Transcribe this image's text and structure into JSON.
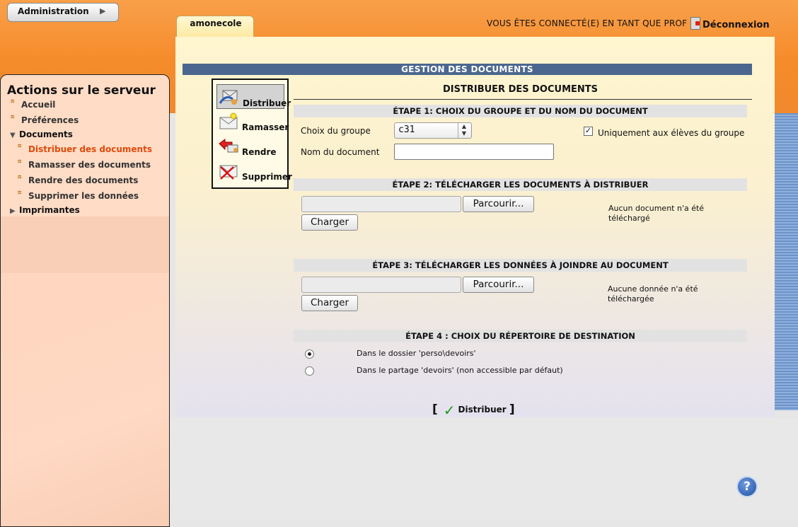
{
  "header": {
    "admin_label": "Administration",
    "tab_label": "amonecole",
    "connected_text": "VOUS ÊTES CONNECTÉ(E) EN TANT QUE PROF",
    "logout_label": "Déconnexion"
  },
  "sidebar": {
    "title": "Actions sur le serveur",
    "items": [
      {
        "label": "Accueil"
      },
      {
        "label": "Préférences"
      },
      {
        "label": "Documents"
      },
      {
        "label": "Distribuer des documents"
      },
      {
        "label": "Ramasser des documents"
      },
      {
        "label": "Rendre des documents"
      },
      {
        "label": "Supprimer les données"
      },
      {
        "label": "Imprimantes"
      }
    ]
  },
  "main": {
    "section_title": "GESTION DES DOCUMENTS",
    "page_title": "DISTRIBUER DES DOCUMENTS",
    "toolbar": [
      {
        "label": "Distribuer"
      },
      {
        "label": "Ramasser"
      },
      {
        "label": "Rendre"
      },
      {
        "label": "Supprimer"
      }
    ],
    "step1": {
      "title": "ÉTAPE 1: CHOIX DU GROUPE ET DU NOM DU DOCUMENT",
      "group_label": "Choix du groupe",
      "group_value": "c31",
      "only_group_label": "Uniquement aux élèves du groupe",
      "doc_name_label": "Nom du document",
      "doc_name_value": ""
    },
    "step2": {
      "title": "ÉTAPE 2: TÉLÉCHARGER LES DOCUMENTS À DISTRIBUER",
      "browse_label": "Parcourir...",
      "load_label": "Charger",
      "status_line1": "Aucun document n'a été",
      "status_line2": "téléchargé"
    },
    "step3": {
      "title": "ÉTAPE 3: TÉLÉCHARGER LES DONNÉES À JOINDRE AU DOCUMENT",
      "browse_label": "Parcourir...",
      "load_label": "Charger",
      "status_line1": "Aucune donnée n'a été",
      "status_line2": "téléchargée"
    },
    "step4": {
      "title": "ÉTAPE 4 : CHOIX DU RÉPERTOIRE DE DESTINATION",
      "option1": "Dans le dossier 'perso\\devoirs'",
      "option2": "Dans le partage 'devoirs' (non accessible par défaut)"
    },
    "submit_label": "Distribuer",
    "help_label": "?"
  },
  "colors": {
    "orange": "#f58b2a",
    "navy_bar": "#4b678f",
    "active_link": "#e04a0a"
  }
}
